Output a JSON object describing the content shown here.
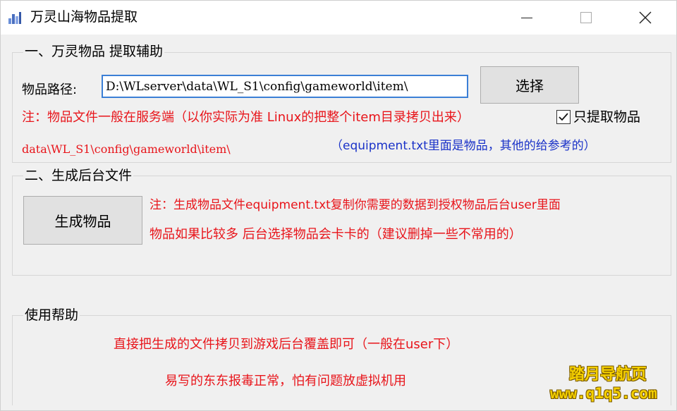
{
  "window": {
    "title": "万灵山海物品提取",
    "icons": {
      "app": "chart-app-icon",
      "minimize": "minimize-icon",
      "maximize": "maximize-icon",
      "close": "close-icon"
    }
  },
  "section1": {
    "title": "一、万灵物品 提取辅助",
    "path_label": "物品路径:",
    "path_value": "D:\\WLserver\\data\\WL_S1\\config\\gameworld\\item\\",
    "select_button": "选择",
    "note_line1": "注：物品文件一般在服务端（以你实际为准 Linux的把整个item目录拷贝出来）",
    "note_line2": "data\\WL_S1\\config\\gameworld\\item\\",
    "checkbox_label": "只提取物品",
    "checkbox_checked": true,
    "hint": "（equipment.txt里面是物品，其他的给参考的）"
  },
  "section2": {
    "title": "二、生成后台文件",
    "generate_button": "生成物品",
    "note_line1": "注：生成物品文件equipment.txt复制你需要的数据到授权物品后台user里面",
    "note_line2": "物品如果比较多 后台选择物品会卡卡的（建议删掉一些不常用的）"
  },
  "section3": {
    "title": "使用帮助",
    "help_line1": "直接把生成的文件拷贝到游戏后台覆盖即可（一般在user下）",
    "help_line2": "易写的东东报毒正常，怕有问题放虚拟机用"
  },
  "watermark": {
    "line1": "踏月导航页",
    "line2": "www.q1q5.com"
  },
  "colors": {
    "note_red": "#e8141a",
    "hint_blue": "#1a32c8",
    "input_border": "#3b7fd6",
    "watermark": "#f5d000"
  }
}
